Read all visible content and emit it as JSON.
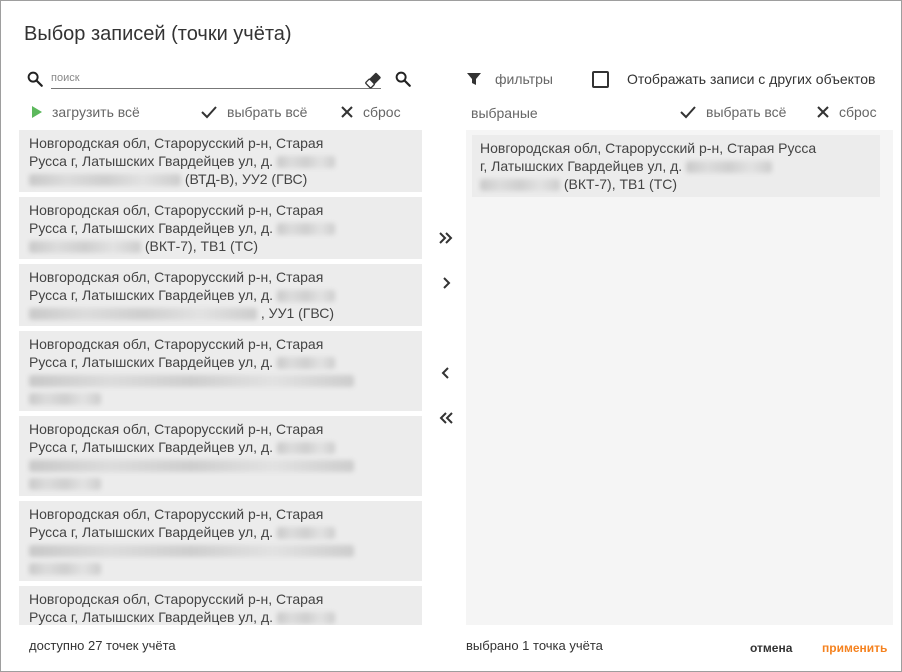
{
  "dialog": {
    "title": "Выбор записей (точки учёта)"
  },
  "left": {
    "search_placeholder": "поиск",
    "search_value": "",
    "load_all_label": "загрузить всё",
    "select_all_label": "выбрать всё",
    "reset_label": "сброс",
    "items": [
      {
        "l1": "Новгородская обл, Старорусский р-н, Старая",
        "l2": "Русса г, Латышских Гвардейцев ул, д.",
        "l3": "(ВТД-В), УУ2 (ГВС)"
      },
      {
        "l1": "Новгородская обл, Старорусский р-н, Старая",
        "l2": "Русса г, Латышских Гвардейцев ул, д.",
        "l3": "(ВКТ-7), ТВ1 (ТС)"
      },
      {
        "l1": "Новгородская обл, Старорусский р-н, Старая",
        "l2": "Русса г, Латышских Гвардейцев ул, д.",
        "l3": ", УУ1 (ГВС)"
      },
      {
        "l1": "Новгородская обл, Старорусский р-н, Старая",
        "l2": "Русса г, Латышских Гвардейцев ул, д.",
        "l3": ""
      },
      {
        "l1": "Новгородская обл, Старорусский р-н, Старая",
        "l2": "Русса г, Латышских Гвардейцев ул, д.",
        "l3": ""
      },
      {
        "l1": "Новгородская обл, Старорусский р-н, Старая",
        "l2": "Русса г, Латышских Гвардейцев ул, д.",
        "l3": ""
      },
      {
        "l1": "Новгородская обл, Старорусский р-н, Старая",
        "l2": "Русса г, Латышских Гвардейцев ул, д.",
        "l3": ""
      }
    ],
    "footer": "доступно 27 точек учёта"
  },
  "right": {
    "filters_label": "фильтры",
    "show_other_label": "Отображать записи с других объектов",
    "show_other_checked": false,
    "selected_label": "выбраные",
    "select_all_label": "выбрать всё",
    "reset_label": "сброс",
    "items": [
      {
        "l1": "Новгородская обл, Старорусский р-н, Старая Русса",
        "l2": "г, Латышских Гвардейцев ул, д.",
        "l3": "(ВКТ-7), ТВ1 (ТС)"
      }
    ],
    "footer": "выбрано 1 точка учёта"
  },
  "transfer": {
    "icons": [
      "double-chevron-right-icon",
      "chevron-right-icon",
      "chevron-left-icon",
      "double-chevron-left-icon"
    ]
  },
  "buttons": {
    "cancel": "отмена",
    "apply": "применить"
  },
  "colors": {
    "accent": "#f5821f",
    "play": "#5cb85c"
  }
}
